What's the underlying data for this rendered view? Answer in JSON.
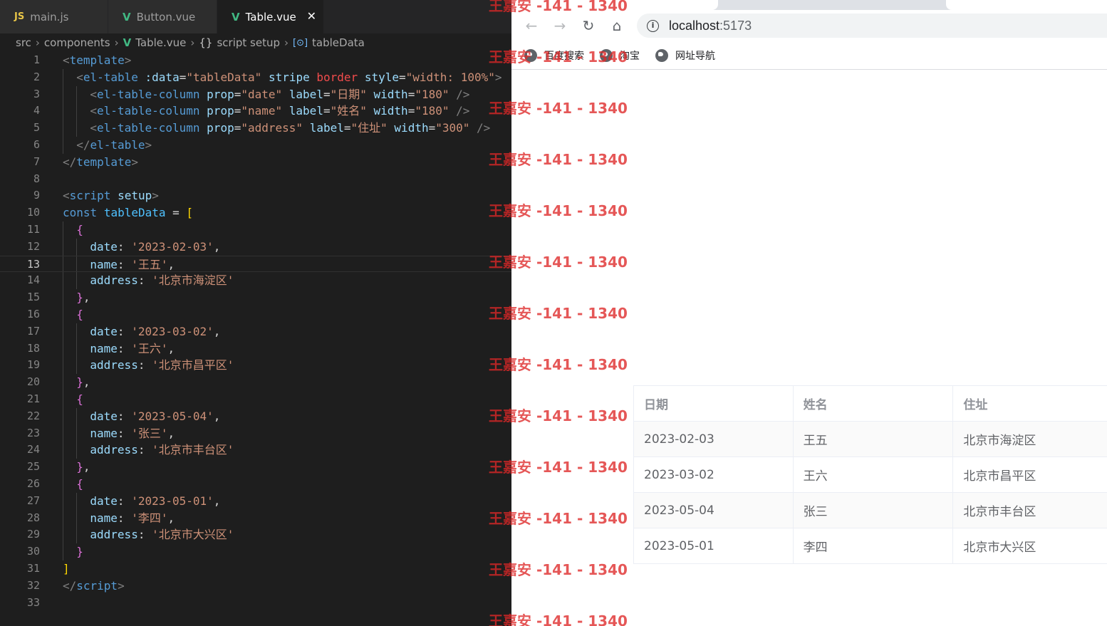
{
  "editor": {
    "tabs": [
      {
        "label": "main.js",
        "icon": "js-icon",
        "active": false
      },
      {
        "label": "Button.vue",
        "icon": "vue-icon",
        "active": false
      },
      {
        "label": "Table.vue",
        "icon": "vue-icon",
        "active": true
      }
    ],
    "close_glyph": "✕",
    "breadcrumb": [
      "src",
      "components",
      "Table.vue",
      "script setup",
      "tableData"
    ],
    "current_line": 13,
    "lines": [
      {
        "n": "1",
        "indent": 0,
        "tokens": [
          [
            "t-punc",
            "<"
          ],
          [
            "t-tag",
            "template"
          ],
          [
            "t-punc",
            ">"
          ]
        ]
      },
      {
        "n": "2",
        "indent": 1,
        "tokens": [
          [
            "t-punc",
            "<"
          ],
          [
            "t-tag",
            "el-table"
          ],
          [
            "t-plain",
            " "
          ],
          [
            "t-attr",
            ":data"
          ],
          [
            "t-plain",
            "="
          ],
          [
            "t-str",
            "\"tableData\""
          ],
          [
            "t-plain",
            " "
          ],
          [
            "t-attr",
            "stripe"
          ],
          [
            "t-plain",
            " "
          ],
          [
            "t-warn",
            "border"
          ],
          [
            "t-plain",
            " "
          ],
          [
            "t-attr",
            "style"
          ],
          [
            "t-plain",
            "="
          ],
          [
            "t-str",
            "\"width: 100%\""
          ],
          [
            "t-punc",
            ">"
          ]
        ]
      },
      {
        "n": "3",
        "indent": 2,
        "tokens": [
          [
            "t-punc",
            "<"
          ],
          [
            "t-tag",
            "el-table-column"
          ],
          [
            "t-plain",
            " "
          ],
          [
            "t-attr",
            "prop"
          ],
          [
            "t-plain",
            "="
          ],
          [
            "t-str",
            "\"date\""
          ],
          [
            "t-plain",
            " "
          ],
          [
            "t-attr",
            "label"
          ],
          [
            "t-plain",
            "="
          ],
          [
            "t-str",
            "\"日期\""
          ],
          [
            "t-plain",
            " "
          ],
          [
            "t-attr",
            "width"
          ],
          [
            "t-plain",
            "="
          ],
          [
            "t-str",
            "\"180\""
          ],
          [
            "t-plain",
            " "
          ],
          [
            "t-punc",
            "/>"
          ]
        ]
      },
      {
        "n": "4",
        "indent": 2,
        "tokens": [
          [
            "t-punc",
            "<"
          ],
          [
            "t-tag",
            "el-table-column"
          ],
          [
            "t-plain",
            " "
          ],
          [
            "t-attr",
            "prop"
          ],
          [
            "t-plain",
            "="
          ],
          [
            "t-str",
            "\"name\""
          ],
          [
            "t-plain",
            " "
          ],
          [
            "t-attr",
            "label"
          ],
          [
            "t-plain",
            "="
          ],
          [
            "t-str",
            "\"姓名\""
          ],
          [
            "t-plain",
            " "
          ],
          [
            "t-attr",
            "width"
          ],
          [
            "t-plain",
            "="
          ],
          [
            "t-str",
            "\"180\""
          ],
          [
            "t-plain",
            " "
          ],
          [
            "t-punc",
            "/>"
          ]
        ]
      },
      {
        "n": "5",
        "indent": 2,
        "tokens": [
          [
            "t-punc",
            "<"
          ],
          [
            "t-tag",
            "el-table-column"
          ],
          [
            "t-plain",
            " "
          ],
          [
            "t-attr",
            "prop"
          ],
          [
            "t-plain",
            "="
          ],
          [
            "t-str",
            "\"address\""
          ],
          [
            "t-plain",
            " "
          ],
          [
            "t-attr",
            "label"
          ],
          [
            "t-plain",
            "="
          ],
          [
            "t-str",
            "\"住址\""
          ],
          [
            "t-plain",
            " "
          ],
          [
            "t-attr",
            "width"
          ],
          [
            "t-plain",
            "="
          ],
          [
            "t-str",
            "\"300\""
          ],
          [
            "t-plain",
            " "
          ],
          [
            "t-punc",
            "/>"
          ]
        ]
      },
      {
        "n": "6",
        "indent": 1,
        "tokens": [
          [
            "t-punc",
            "</"
          ],
          [
            "t-tag",
            "el-table"
          ],
          [
            "t-punc",
            ">"
          ]
        ]
      },
      {
        "n": "7",
        "indent": 0,
        "tokens": [
          [
            "t-punc",
            "</"
          ],
          [
            "t-tag",
            "template"
          ],
          [
            "t-punc",
            ">"
          ]
        ]
      },
      {
        "n": "8",
        "indent": 0,
        "tokens": []
      },
      {
        "n": "9",
        "indent": 0,
        "tokens": [
          [
            "t-punc",
            "<"
          ],
          [
            "t-tag",
            "script"
          ],
          [
            "t-plain",
            " "
          ],
          [
            "t-attr",
            "setup"
          ],
          [
            "t-punc",
            ">"
          ]
        ]
      },
      {
        "n": "10",
        "indent": 0,
        "tokens": [
          [
            "t-kw",
            "const"
          ],
          [
            "t-plain",
            " "
          ],
          [
            "t-var",
            "tableData"
          ],
          [
            "t-plain",
            " = "
          ],
          [
            "t-b1",
            "["
          ]
        ]
      },
      {
        "n": "11",
        "indent": 1,
        "tokens": [
          [
            "t-b2",
            "{"
          ]
        ]
      },
      {
        "n": "12",
        "indent": 2,
        "tokens": [
          [
            "t-attr",
            "date"
          ],
          [
            "t-plain",
            ": "
          ],
          [
            "t-str",
            "'2023-02-03'"
          ],
          [
            "t-plain",
            ","
          ]
        ]
      },
      {
        "n": "13",
        "indent": 2,
        "tokens": [
          [
            "t-attr",
            "name"
          ],
          [
            "t-plain",
            ": "
          ],
          [
            "t-str",
            "'王五'"
          ],
          [
            "t-plain",
            ","
          ]
        ]
      },
      {
        "n": "14",
        "indent": 2,
        "tokens": [
          [
            "t-attr",
            "address"
          ],
          [
            "t-plain",
            ": "
          ],
          [
            "t-str",
            "'北京市海淀区'"
          ]
        ]
      },
      {
        "n": "15",
        "indent": 1,
        "tokens": [
          [
            "t-b2",
            "}"
          ],
          [
            "t-plain",
            ","
          ]
        ]
      },
      {
        "n": "16",
        "indent": 1,
        "tokens": [
          [
            "t-b2",
            "{"
          ]
        ]
      },
      {
        "n": "17",
        "indent": 2,
        "tokens": [
          [
            "t-attr",
            "date"
          ],
          [
            "t-plain",
            ": "
          ],
          [
            "t-str",
            "'2023-03-02'"
          ],
          [
            "t-plain",
            ","
          ]
        ]
      },
      {
        "n": "18",
        "indent": 2,
        "tokens": [
          [
            "t-attr",
            "name"
          ],
          [
            "t-plain",
            ": "
          ],
          [
            "t-str",
            "'王六'"
          ],
          [
            "t-plain",
            ","
          ]
        ]
      },
      {
        "n": "19",
        "indent": 2,
        "tokens": [
          [
            "t-attr",
            "address"
          ],
          [
            "t-plain",
            ": "
          ],
          [
            "t-str",
            "'北京市昌平区'"
          ]
        ]
      },
      {
        "n": "20",
        "indent": 1,
        "tokens": [
          [
            "t-b2",
            "}"
          ],
          [
            "t-plain",
            ","
          ]
        ]
      },
      {
        "n": "21",
        "indent": 1,
        "tokens": [
          [
            "t-b2",
            "{"
          ]
        ]
      },
      {
        "n": "22",
        "indent": 2,
        "tokens": [
          [
            "t-attr",
            "date"
          ],
          [
            "t-plain",
            ": "
          ],
          [
            "t-str",
            "'2023-05-04'"
          ],
          [
            "t-plain",
            ","
          ]
        ]
      },
      {
        "n": "23",
        "indent": 2,
        "tokens": [
          [
            "t-attr",
            "name"
          ],
          [
            "t-plain",
            ": "
          ],
          [
            "t-str",
            "'张三'"
          ],
          [
            "t-plain",
            ","
          ]
        ]
      },
      {
        "n": "24",
        "indent": 2,
        "tokens": [
          [
            "t-attr",
            "address"
          ],
          [
            "t-plain",
            ": "
          ],
          [
            "t-str",
            "'北京市丰台区'"
          ]
        ]
      },
      {
        "n": "25",
        "indent": 1,
        "tokens": [
          [
            "t-b2",
            "}"
          ],
          [
            "t-plain",
            ","
          ]
        ]
      },
      {
        "n": "26",
        "indent": 1,
        "tokens": [
          [
            "t-b2",
            "{"
          ]
        ]
      },
      {
        "n": "27",
        "indent": 2,
        "tokens": [
          [
            "t-attr",
            "date"
          ],
          [
            "t-plain",
            ": "
          ],
          [
            "t-str",
            "'2023-05-01'"
          ],
          [
            "t-plain",
            ","
          ]
        ]
      },
      {
        "n": "28",
        "indent": 2,
        "tokens": [
          [
            "t-attr",
            "name"
          ],
          [
            "t-plain",
            ": "
          ],
          [
            "t-str",
            "'李四'"
          ],
          [
            "t-plain",
            ","
          ]
        ]
      },
      {
        "n": "29",
        "indent": 2,
        "tokens": [
          [
            "t-attr",
            "address"
          ],
          [
            "t-plain",
            ": "
          ],
          [
            "t-str",
            "'北京市大兴区'"
          ]
        ]
      },
      {
        "n": "30",
        "indent": 1,
        "tokens": [
          [
            "t-b2",
            "}"
          ]
        ]
      },
      {
        "n": "31",
        "indent": 0,
        "tokens": [
          [
            "t-b1",
            "]"
          ]
        ]
      },
      {
        "n": "32",
        "indent": 0,
        "tokens": [
          [
            "t-punc",
            "</"
          ],
          [
            "t-tag",
            "script"
          ],
          [
            "t-punc",
            ">"
          ]
        ]
      },
      {
        "n": "33",
        "indent": 0,
        "tokens": []
      }
    ]
  },
  "browser": {
    "url_host": "localhost",
    "url_port": ":5173",
    "nav": {
      "back": "←",
      "forward": "→",
      "reload": "↻",
      "home": "⌂"
    },
    "bookmarks": [
      {
        "label": "百度搜索",
        "icon": "globe-icon"
      },
      {
        "label": "淘宝",
        "icon": "globe-icon"
      },
      {
        "label": "网址导航",
        "icon": "globe-icon"
      }
    ],
    "table": {
      "headers": [
        "日期",
        "姓名",
        "住址"
      ],
      "rows": [
        [
          "2023-02-03",
          "王五",
          "北京市海淀区"
        ],
        [
          "2023-03-02",
          "王六",
          "北京市昌平区"
        ],
        [
          "2023-05-04",
          "张三",
          "北京市丰台区"
        ],
        [
          "2023-05-01",
          "李四",
          "北京市大兴区"
        ]
      ]
    }
  },
  "watermark": {
    "text": "王嘉安 -141 - 1340",
    "count": 13
  },
  "colors": {
    "editor_bg": "#1e1e1e",
    "vue_green": "#41b883",
    "watermark_red": "#de2828"
  }
}
